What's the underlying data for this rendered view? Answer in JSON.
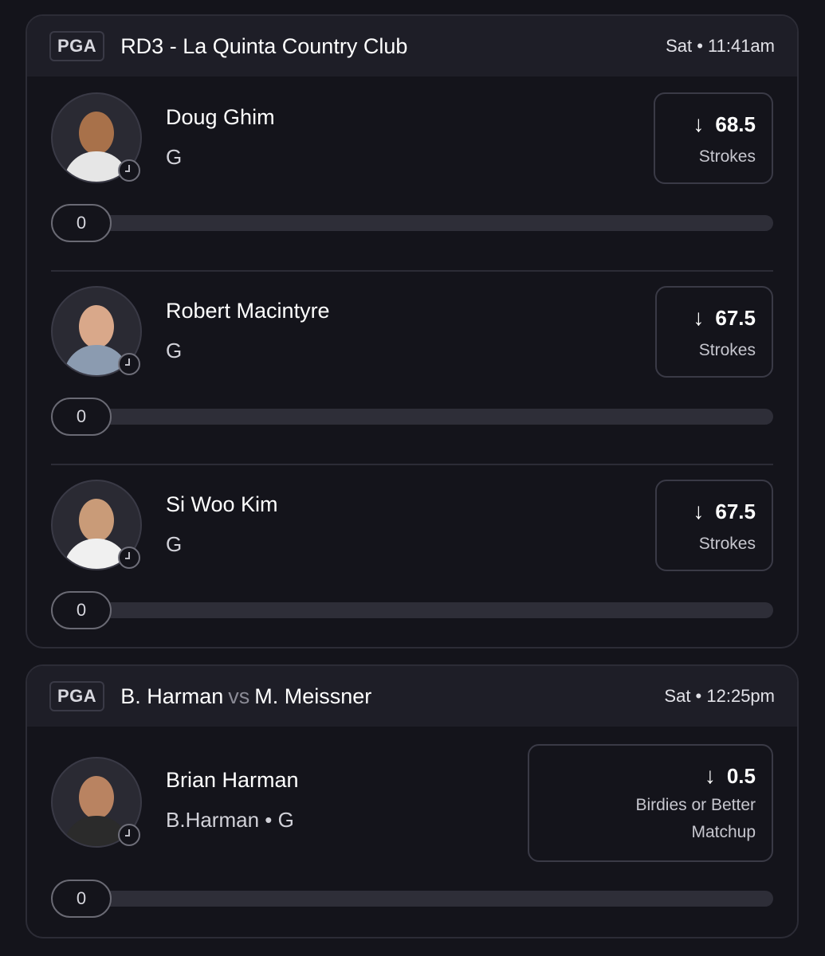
{
  "cards": [
    {
      "league": "PGA",
      "title": "RD3 - La Quinta Country Club",
      "time": "Sat • 11:41am",
      "picks": [
        {
          "name": "Doug Ghim",
          "sub": "G",
          "line": "68.5",
          "stat": "Strokes",
          "stat2": "",
          "progress": "0"
        },
        {
          "name": "Robert Macintyre",
          "sub": "G",
          "line": "67.5",
          "stat": "Strokes",
          "stat2": "",
          "progress": "0"
        },
        {
          "name": "Si Woo Kim",
          "sub": "G",
          "line": "67.5",
          "stat": "Strokes",
          "stat2": "",
          "progress": "0"
        }
      ]
    },
    {
      "league": "PGA",
      "title_left": "B. Harman",
      "title_vs": "vs",
      "title_right": "M. Meissner",
      "time": "Sat • 12:25pm",
      "picks": [
        {
          "name": "Brian Harman",
          "sub": "B.Harman • G",
          "line": "0.5",
          "stat": "Birdies or Better",
          "stat2": "Matchup",
          "progress": "0"
        }
      ]
    }
  ],
  "icons": {
    "direction": "arrow-down-icon",
    "status": "clock-icon"
  }
}
